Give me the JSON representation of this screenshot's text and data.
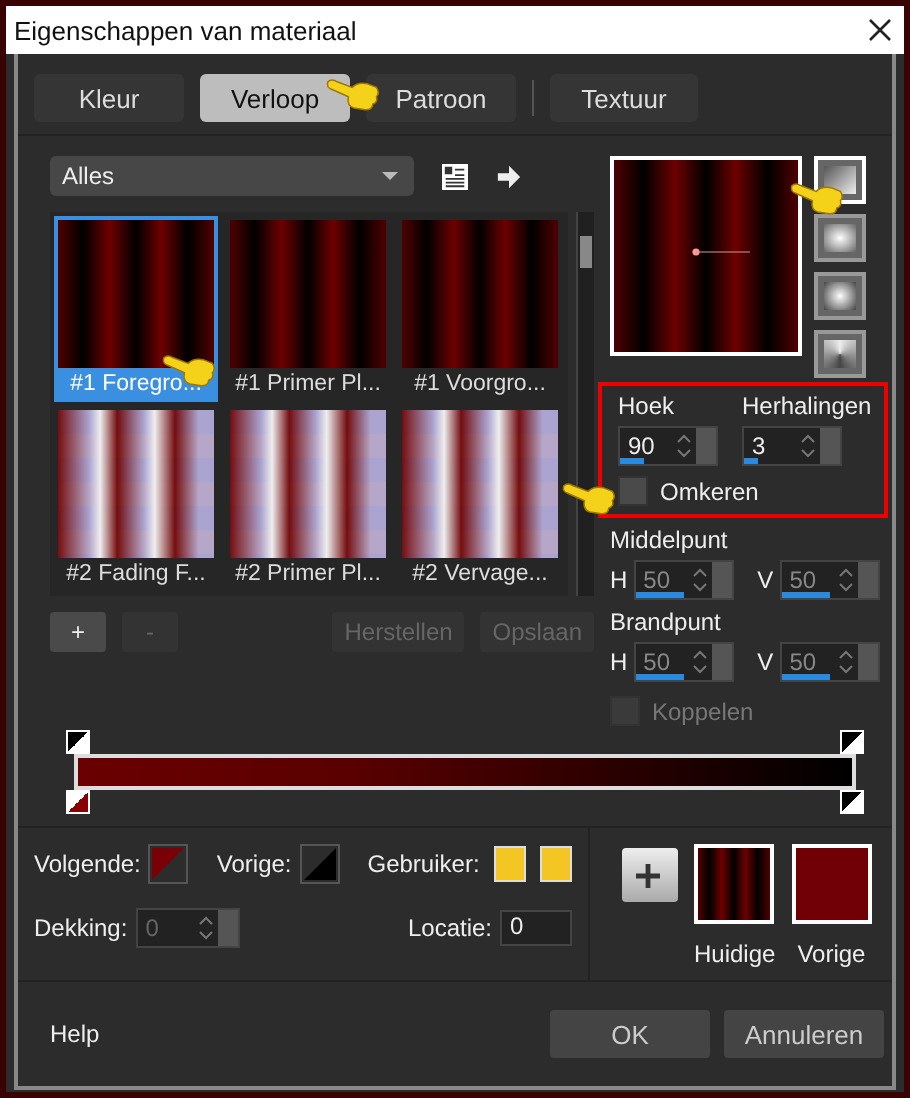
{
  "window": {
    "title": "Eigenschappen van materiaal"
  },
  "tabs": [
    {
      "label": "Kleur",
      "selected": false
    },
    {
      "label": "Verloop",
      "selected": true
    },
    {
      "label": "Patroon",
      "selected": false
    },
    {
      "label": "Textuur",
      "selected": false
    }
  ],
  "category": {
    "value": "Alles"
  },
  "gradients": [
    {
      "label": "#1 Foregro...",
      "selected": true,
      "kind": "stripes"
    },
    {
      "label": "#1 Primer Pl...",
      "selected": false,
      "kind": "stripes"
    },
    {
      "label": "#1 Voorgro...",
      "selected": false,
      "kind": "stripes"
    },
    {
      "label": "#2 Fading F...",
      "selected": false,
      "kind": "checks"
    },
    {
      "label": "#2 Primer Pl...",
      "selected": false,
      "kind": "checks"
    },
    {
      "label": "#2 Vervage...",
      "selected": false,
      "kind": "checks"
    }
  ],
  "style_buttons": [
    {
      "kind": "linear",
      "selected": true
    },
    {
      "kind": "rectangular",
      "selected": false
    },
    {
      "kind": "radial",
      "selected": false
    },
    {
      "kind": "sunburst",
      "selected": false
    }
  ],
  "angle": {
    "label": "Hoek",
    "value": "90",
    "level": 0.25
  },
  "repeats": {
    "label": "Herhalingen",
    "value": "3",
    "level": 0.15
  },
  "invert": {
    "label": "Omkeren",
    "checked": false
  },
  "center": {
    "label": "Middelpunt",
    "h": {
      "label": "H",
      "value": "50",
      "level": 0.5
    },
    "v": {
      "label": "V",
      "value": "50",
      "level": 0.5
    }
  },
  "focal": {
    "label": "Brandpunt",
    "h": {
      "label": "H",
      "value": "50",
      "level": 0.5
    },
    "v": {
      "label": "V",
      "value": "50",
      "level": 0.5
    }
  },
  "link": {
    "label": "Koppelen",
    "checked": false,
    "disabled": true
  },
  "stop_buttons": [
    {
      "label": "+",
      "disabled": false
    },
    {
      "label": "-",
      "disabled": true
    }
  ],
  "file_buttons": [
    {
      "label": "Herstellen",
      "disabled": true
    },
    {
      "label": "Opslaan",
      "disabled": true
    }
  ],
  "next_stop": {
    "label": "Volgende:"
  },
  "prev_stop": {
    "label": "Vorige:"
  },
  "user": {
    "label": "Gebruiker:"
  },
  "opacity": {
    "label": "Dekking:",
    "value": "0",
    "disabled": true
  },
  "location": {
    "label": "Locatie:",
    "value": "0"
  },
  "swatches": [
    {
      "label": "Huidige",
      "kind": "gradient"
    },
    {
      "label": "Vorige",
      "kind": "solid"
    }
  ],
  "buttons": [
    {
      "label": "Help",
      "kind": "link"
    },
    {
      "label": "OK",
      "kind": "button"
    },
    {
      "label": "Annuleren",
      "kind": "button"
    }
  ]
}
